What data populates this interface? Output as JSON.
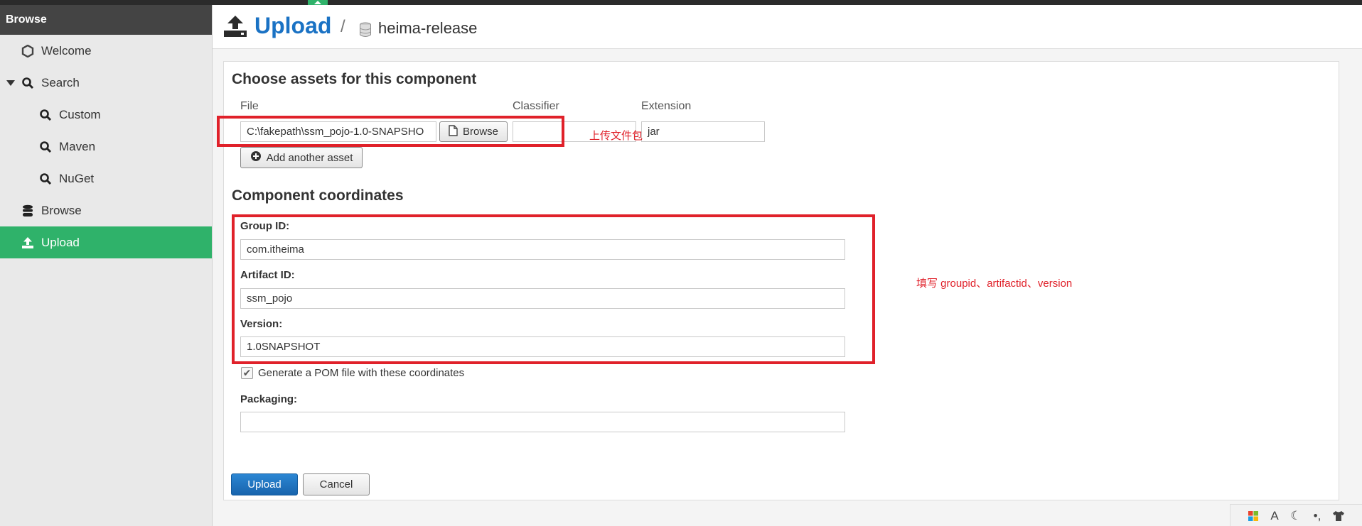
{
  "sidebar": {
    "header": "Browse",
    "items": [
      {
        "label": "Welcome",
        "icon": "hexagon-icon"
      },
      {
        "label": "Search",
        "icon": "search-icon",
        "expanded": true
      },
      {
        "label": "Custom",
        "icon": "search-icon"
      },
      {
        "label": "Maven",
        "icon": "search-icon"
      },
      {
        "label": "NuGet",
        "icon": "search-icon"
      },
      {
        "label": "Browse",
        "icon": "database-icon"
      },
      {
        "label": "Upload",
        "icon": "upload-icon",
        "active": true
      }
    ]
  },
  "header": {
    "title": "Upload",
    "separator": "/",
    "repository": "heima-release"
  },
  "assets": {
    "title": "Choose assets for this component",
    "file_label": "File",
    "classifier_label": "Classifier",
    "extension_label": "Extension",
    "file_value": "C:\\fakepath\\ssm_pojo-1.0-SNAPSHO",
    "browse_label": "Browse",
    "classifier_value": "",
    "extension_value": "jar",
    "add_asset_label": "Add another asset"
  },
  "coordinates": {
    "title": "Component coordinates",
    "group_label": "Group ID:",
    "group_value": "com.itheima",
    "artifact_label": "Artifact ID:",
    "artifact_value": "ssm_pojo",
    "version_label": "Version:",
    "version_value": "1.0SNAPSHOT",
    "pom_label": "Generate a POM file with these coordinates",
    "pom_checked": true,
    "packaging_label": "Packaging:",
    "packaging_value": ""
  },
  "actions": {
    "upload_label": "Upload",
    "cancel_label": "Cancel"
  },
  "annotations": {
    "file_note": "上传文件包",
    "coords_note": "填写 groupid、artifactid、version"
  },
  "colors": {
    "accent": "#2fb26a",
    "primary": "#1a72c4",
    "annotation": "#e0212a"
  }
}
